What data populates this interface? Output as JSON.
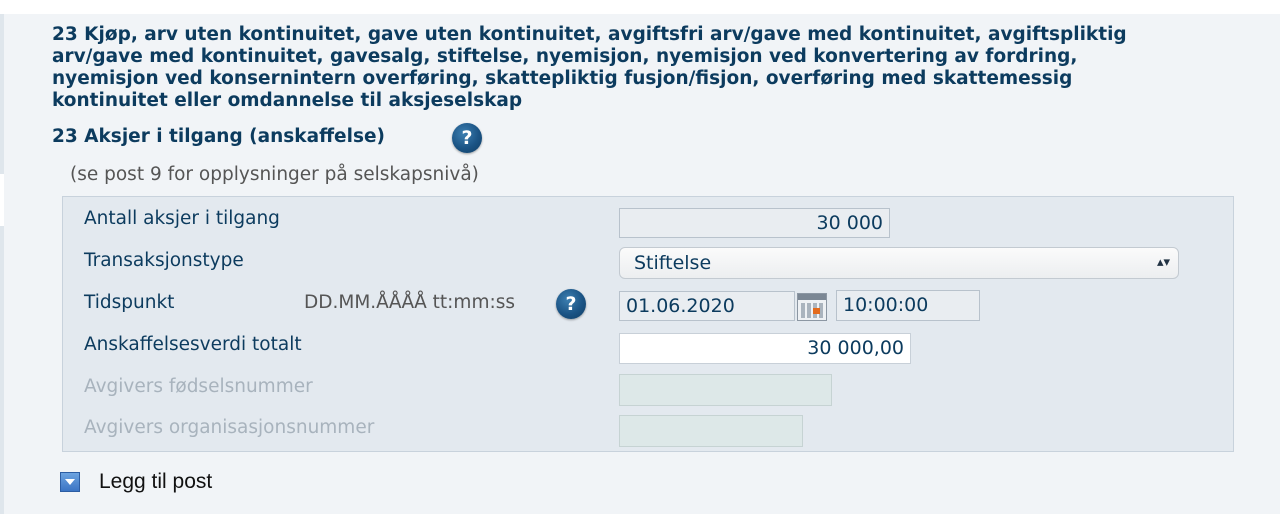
{
  "section": {
    "heading": "23 Kjøp, arv uten kontinuitet, gave uten kontinuitet, avgiftsfri arv/gave med kontinuitet, avgiftspliktig arv/gave med kontinuitet, gavesalg, stiftelse, nyemisjon, nyemisjon ved konvertering av fordring, nyemisjon ved konsernintern overføring, skattepliktig fusjon/fisjon, overføring med skattemessig kontinuitet eller omdannelse til aksjeselskap",
    "subheading": "23 Aksjer i tilgang (anskaffelse)",
    "help_glyph": "?",
    "note": "(se post 9 for opplysninger på selskapsnivå)"
  },
  "form": {
    "antall": {
      "label": "Antall aksjer i tilgang",
      "value": "30 000"
    },
    "transaksjonstype": {
      "label": "Transaksjonstype",
      "selected": "Stiftelse",
      "arrow_glyph": "▴▾"
    },
    "tidspunkt": {
      "label": "Tidspunkt",
      "format_hint": "DD.MM.ÅÅÅÅ tt:mm:ss",
      "date_value": "01.06.2020",
      "time_value": "10:00:00"
    },
    "anskaffelsesverdi": {
      "label": "Anskaffelsesverdi totalt",
      "value": "30 000,00"
    },
    "fodselsnummer": {
      "label": "Avgivers fødselsnummer",
      "value": ""
    },
    "orgnummer": {
      "label": "Avgivers organisasjonsnummer",
      "value": ""
    }
  },
  "actions": {
    "add_post_label": "Legg til post"
  },
  "colors": {
    "heading": "#0c3b5e",
    "panel_bg": "#f1f4f7",
    "form_bg": "#e3e9ef",
    "disabled_label": "#a8b3bd",
    "help_icon": "#1b5485"
  },
  "icons": {
    "help": "help-icon",
    "calendar": "calendar-icon",
    "add": "expand-arrow-icon"
  }
}
